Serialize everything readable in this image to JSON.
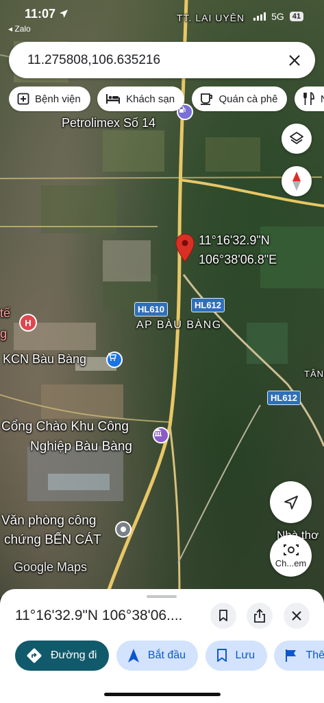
{
  "status_bar": {
    "time": "11:07",
    "back_app": "◂ Zalo",
    "network": "5G",
    "battery": "41"
  },
  "search": {
    "value": "11.275808,106.635216"
  },
  "chips": [
    {
      "label": "Bệnh viện",
      "icon": "hospital-plus-icon"
    },
    {
      "label": "Khách sạn",
      "icon": "bed-icon"
    },
    {
      "label": "Quán cà phê",
      "icon": "coffee-cup-icon"
    },
    {
      "label": "Nh",
      "icon": "restaurant-icon"
    }
  ],
  "map": {
    "labels": {
      "top_town": "TT. LAI UYÊN",
      "petrolimex": "Petrolimex Số 14",
      "pin_lat": "11°16'32.9\"N",
      "pin_lng": "106°38'06.8\"E",
      "area": "AP BÀU BÀNG",
      "clinic_partial_1": "tế",
      "clinic_partial_2": "g",
      "kcn": "KCN Bàu Bàng",
      "gate_line1": "Cổng Chào Khu Công",
      "gate_line2": "Nghiệp Bàu Bàng",
      "office_line1": "Văn phòng công",
      "office_line2": "chứng BẾN CÁT",
      "tan_partial": "TÂN",
      "nha_partial": "Nhà thơ",
      "brand": "Google Maps"
    },
    "road_badges": {
      "hl610": "HL610",
      "hl612_a": "HL612",
      "hl612_b": "HL612"
    },
    "colors": {
      "road_badge": "#2f6fb8",
      "pin": "#d93025",
      "road": "#e8c766"
    }
  },
  "map_buttons": {
    "layers": "layers-icon",
    "compass": "compass-icon",
    "location": "my-location-arrow-icon",
    "lens_label": "Ch...em"
  },
  "sheet": {
    "title": "11°16'32.9\"N 106°38'06....",
    "actions": [
      {
        "label": "Đường đi",
        "icon": "directions-icon"
      },
      {
        "label": "Bắt đầu",
        "icon": "navigation-arrow-icon"
      },
      {
        "label": "Lưu",
        "icon": "bookmark-icon"
      },
      {
        "label": "Thêm",
        "icon": "flag-icon"
      }
    ]
  }
}
